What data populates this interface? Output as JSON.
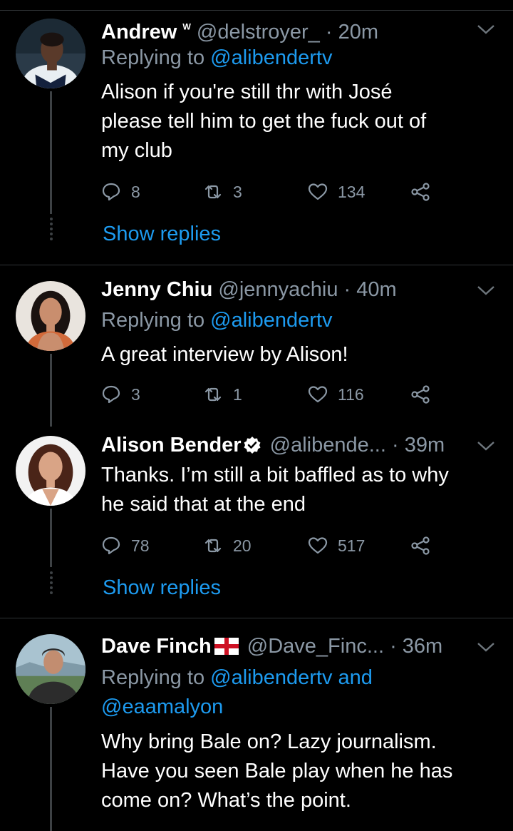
{
  "tweets": [
    {
      "name": "Andrew",
      "name_suffix": "ᵂ",
      "handle": "@delstroyer_",
      "time": "· 20m",
      "replying_prefix": "Replying to",
      "replying_to": "@alibendertv",
      "replying_extra": "",
      "text_lines": [
        "Alison if you're still thr with José",
        "please tell him to get the fuck out of",
        "my club"
      ],
      "replies": "8",
      "retweets": "3",
      "likes": "134",
      "show_replies": "Show replies"
    },
    {
      "name": "Jenny Chiu",
      "handle": "@jennyachiu",
      "time": "· 40m",
      "replying_prefix": "Replying to",
      "replying_to": "@alibendertv",
      "text_lines": [
        "A great interview by Alison!"
      ],
      "replies": "3",
      "retweets": "1",
      "likes": "116"
    },
    {
      "name": "Alison Bender",
      "verified": true,
      "handle": "@alibende...",
      "time": "· 39m",
      "text_lines": [
        "Thanks. I’m still a bit baffled as to why",
        "he said that at the end"
      ],
      "replies": "78",
      "retweets": "20",
      "likes": "517",
      "show_replies": "Show replies"
    },
    {
      "name": "Dave Finch",
      "flag": "england-flag",
      "handle": "@Dave_Finc...",
      "time": "· 36m",
      "replying_prefix": "Replying to",
      "replying_to": "@alibendertv and",
      "replying_to_2": "@eaamalyon",
      "text_lines": [
        "Why bring Bale on? Lazy journalism.",
        "Have you seen Bale play when he has",
        "come on? What’s the point."
      ]
    }
  ],
  "colors": {
    "background": "#000000",
    "secondary_text": "#8b98a5",
    "link": "#1d9bf0",
    "divider": "#2f3336"
  },
  "icons": [
    "reply-icon",
    "retweet-icon",
    "like-icon",
    "share-icon",
    "chevron-down-icon",
    "verified-badge-icon"
  ]
}
